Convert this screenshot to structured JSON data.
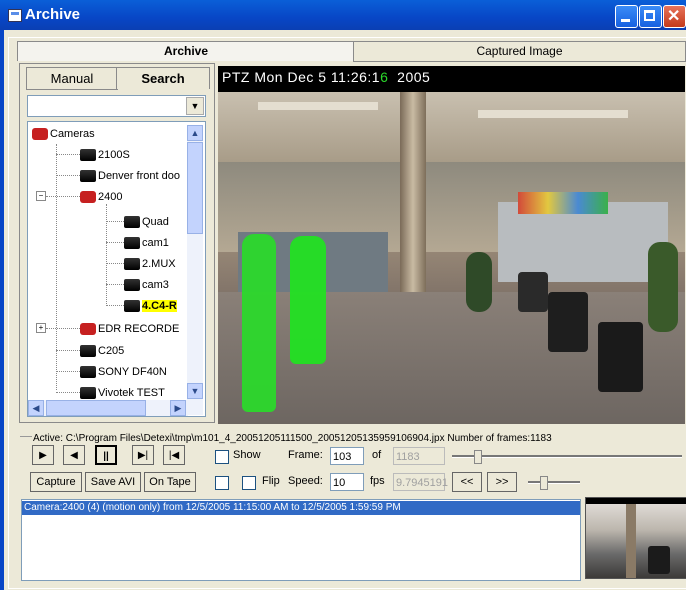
{
  "window": {
    "title": "Archive"
  },
  "tabs": [
    "Archive",
    "Captured Image"
  ],
  "subtabs": [
    "Manual",
    "Search"
  ],
  "tree": {
    "items": [
      {
        "label": "Cameras",
        "icon": "camera-group-icon"
      },
      {
        "label": "2100S",
        "icon": "camera-icon"
      },
      {
        "label": "Denver front doo",
        "icon": "camera-icon"
      },
      {
        "label": "2400",
        "icon": "camera-group-icon"
      },
      {
        "label": "Quad",
        "icon": "camera-icon"
      },
      {
        "label": "cam1",
        "icon": "camera-icon"
      },
      {
        "label": "2.MUX",
        "icon": "camera-icon"
      },
      {
        "label": "cam3",
        "icon": "camera-icon"
      },
      {
        "label": "4.C4-R",
        "icon": "camera-icon"
      },
      {
        "label": "EDR RECORDE",
        "icon": "recorder-icon"
      },
      {
        "label": "C205",
        "icon": "camera-icon"
      },
      {
        "label": "SONY DF40N",
        "icon": "camera-icon"
      },
      {
        "label": "Vivotek TEST",
        "icon": "camera-icon"
      }
    ]
  },
  "video": {
    "osd": "PTZ  Mon Dec  5  11:26:1",
    "osd_green": "6",
    "osd_year": "2005"
  },
  "status": {
    "active_line": "Active: C:\\Program Files\\Detexi\\tmp\\m101_4_20051205111500_20051205135959106904.jpx  Number of frames:1183"
  },
  "playback": {
    "buttons": [
      "▶",
      "◀",
      "||",
      "▶|",
      "|◀"
    ],
    "show_label": "Show",
    "flip_label": "Flip",
    "frame_label": "Frame:",
    "frame_value": "103",
    "of_label": "of",
    "of_value": "1183",
    "speed_label": "Speed:",
    "speed_value": "10",
    "fps_label": "fps",
    "fps_value": "9.7945191",
    "prev_label": "<<",
    "next_label": ">>"
  },
  "actions": {
    "capture": "Capture",
    "save_avi": "Save AVI",
    "on_tape": "On Tape"
  },
  "results": [
    "Camera:2400 (4) (motion only) from 12/5/2005 11:15:00 AM to 12/5/2005 1:59:59 PM"
  ]
}
